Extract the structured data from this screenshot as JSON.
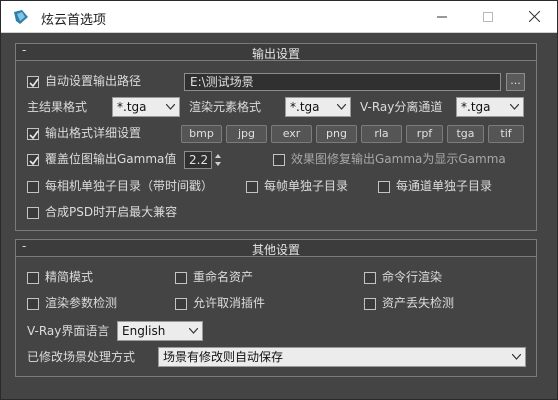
{
  "window": {
    "title": "炫云首选项",
    "icon": "xuanyun-logo-icon"
  },
  "output_section": {
    "title": "输出设置",
    "collapse_symbol": "-",
    "auto_output_path": {
      "label": "自动设置输出路径",
      "checked": true,
      "value": "E:\\测试场景",
      "browse_label": "..."
    },
    "main_format": {
      "label": "主结果格式",
      "value": "*.tga"
    },
    "element_format": {
      "label": "渲染元素格式",
      "value": "*.tga"
    },
    "vray_channel": {
      "label": "V-Ray分离通道",
      "value": "*.tga"
    },
    "format_detail": {
      "label": "输出格式详细设置",
      "checked": true,
      "buttons": [
        "bmp",
        "jpg",
        "exr",
        "png",
        "rla",
        "rpf",
        "tga",
        "tif"
      ]
    },
    "gamma_override": {
      "label": "覆盖位图输出Gamma值",
      "checked": true,
      "value": "2.2"
    },
    "effect_gamma": {
      "label": "效果图修复输出Gamma为显示Gamma",
      "checked": false
    },
    "per_camera": {
      "label": "每相机单独子目录（带时间戳）",
      "checked": false
    },
    "per_frame": {
      "label": "每帧单独子目录",
      "checked": false
    },
    "per_channel": {
      "label": "每通道单独子目录",
      "checked": false
    },
    "psd_compat": {
      "label": "合成PSD时开启最大兼容",
      "checked": false
    }
  },
  "other_section": {
    "title": "其他设置",
    "collapse_symbol": "-",
    "simple_mode": {
      "label": "精简模式",
      "checked": false
    },
    "rename_assets": {
      "label": "重命名资产",
      "checked": false
    },
    "command_render": {
      "label": "命令行渲染",
      "checked": false
    },
    "render_param_check": {
      "label": "渲染参数检测",
      "checked": false
    },
    "allow_cancel_plugin": {
      "label": "允许取消插件",
      "checked": false
    },
    "missing_asset_check": {
      "label": "资产丢失检测",
      "checked": false
    },
    "vray_language": {
      "label": "V-Ray界面语言",
      "value": "English"
    },
    "modified_scene": {
      "label": "已修改场景处理方式",
      "value": "场景有修改则自动保存"
    }
  },
  "colors": {
    "window_bg": "#444444",
    "titlebar_bg": "#ffffff",
    "group_border": "#7a7a7a",
    "text": "#dcdcdc"
  }
}
